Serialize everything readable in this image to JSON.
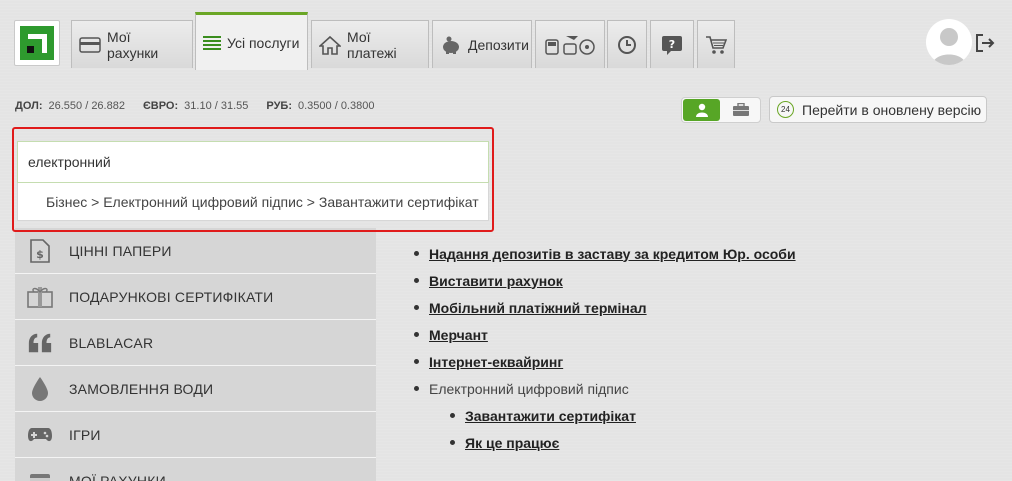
{
  "tabs": [
    {
      "label": "Мої рахунки",
      "icon": "card-icon"
    },
    {
      "label": "Усі послуги",
      "icon": "list-icon",
      "active": true
    },
    {
      "label": "Мої платежі",
      "icon": "house-icon"
    },
    {
      "label": "Депозити",
      "icon": "piggy-bank-icon"
    },
    {
      "label": "",
      "icon": "transport-icon"
    },
    {
      "label": "",
      "icon": "history-icon"
    },
    {
      "label": "",
      "icon": "help-icon"
    },
    {
      "label": "",
      "icon": "cart-icon"
    }
  ],
  "rates": [
    {
      "name": "ДОЛ:",
      "value": "26.550 / 26.882"
    },
    {
      "name": "ЄВРО:",
      "value": "31.10 / 31.55"
    },
    {
      "name": "РУБ:",
      "value": "0.3500 / 0.3800"
    }
  ],
  "new_version": {
    "badge": "24",
    "label": "Перейти в оновлену версію"
  },
  "search": {
    "value": "електронний",
    "suggestion": "Бізнес > Електронний цифровий підпис > Завантажити сертифікат"
  },
  "menu": [
    {
      "label": "ЦІННІ ПАПЕРИ",
      "icon": "document-dollar-icon"
    },
    {
      "label": "ПОДАРУНКОВІ СЕРТИФІКАТИ",
      "icon": "gift-icon"
    },
    {
      "label": "BLABLACAR",
      "icon": "quote-icon"
    },
    {
      "label": "ЗАМОВЛЕННЯ ВОДИ",
      "icon": "water-drop-icon"
    },
    {
      "label": "ІГРИ",
      "icon": "gamepad-icon"
    },
    {
      "label": "МОЇ РАХУНКИ",
      "icon": "card-icon"
    }
  ],
  "links": [
    {
      "label": "Надання депозитів в заставу за кредитом Юр. особи",
      "link": true
    },
    {
      "label": "Виставити рахунок",
      "link": true
    },
    {
      "label": "Мобільний платіжний термінал",
      "link": true
    },
    {
      "label": "Мерчант",
      "link": true
    },
    {
      "label": "Інтернет-еквайринг",
      "link": true
    },
    {
      "label": "Електронний цифровий підпис",
      "link": false
    },
    {
      "label": "Завантажити сертифікат",
      "link": true,
      "sub": true
    },
    {
      "label": "Як це працює",
      "link": true,
      "sub": true
    }
  ]
}
